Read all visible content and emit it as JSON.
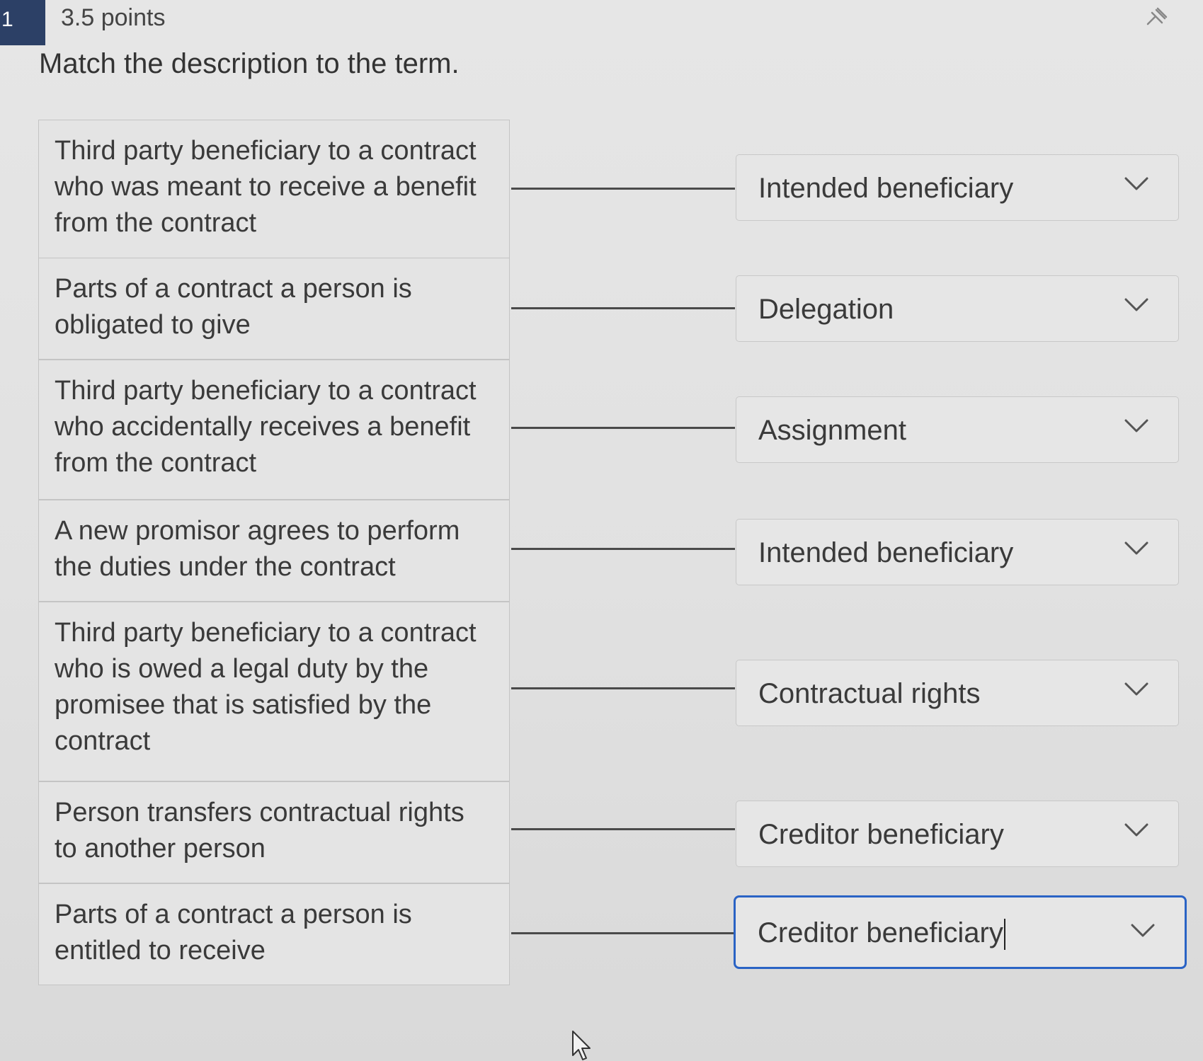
{
  "question": {
    "number": "1",
    "points": "3.5 points",
    "prompt": "Match the description to the term."
  },
  "pairs": [
    {
      "description": "Third party beneficiary to a contract who was meant to receive a benefit from the contract",
      "selected_term": "Intended beneficiary"
    },
    {
      "description": "Parts of a contract a person is obligated to give",
      "selected_term": "Delegation"
    },
    {
      "description": "Third party beneficiary to a contract who accidentally receives a benefit from the contract",
      "selected_term": "Assignment"
    },
    {
      "description": "A new promisor agrees to perform the duties under the contract",
      "selected_term": "Intended beneficiary"
    },
    {
      "description": "Third party beneficiary to a contract who is owed a legal duty by the promisee that is satisfied by the contract",
      "selected_term": "Contractual rights"
    },
    {
      "description": "Person transfers contractual rights to another person",
      "selected_term": "Creditor beneficiary"
    },
    {
      "description": "Parts of a contract a person is entitled to receive",
      "selected_term": "Creditor beneficiary"
    }
  ],
  "icons": {
    "pin": "pin-icon",
    "dropdown": "chevron-down-icon",
    "cursor": "mouse-pointer-icon"
  },
  "colors": {
    "question_badge": "#2c4066",
    "focus_border": "#2a63c5",
    "background": "#e3e3e3"
  }
}
